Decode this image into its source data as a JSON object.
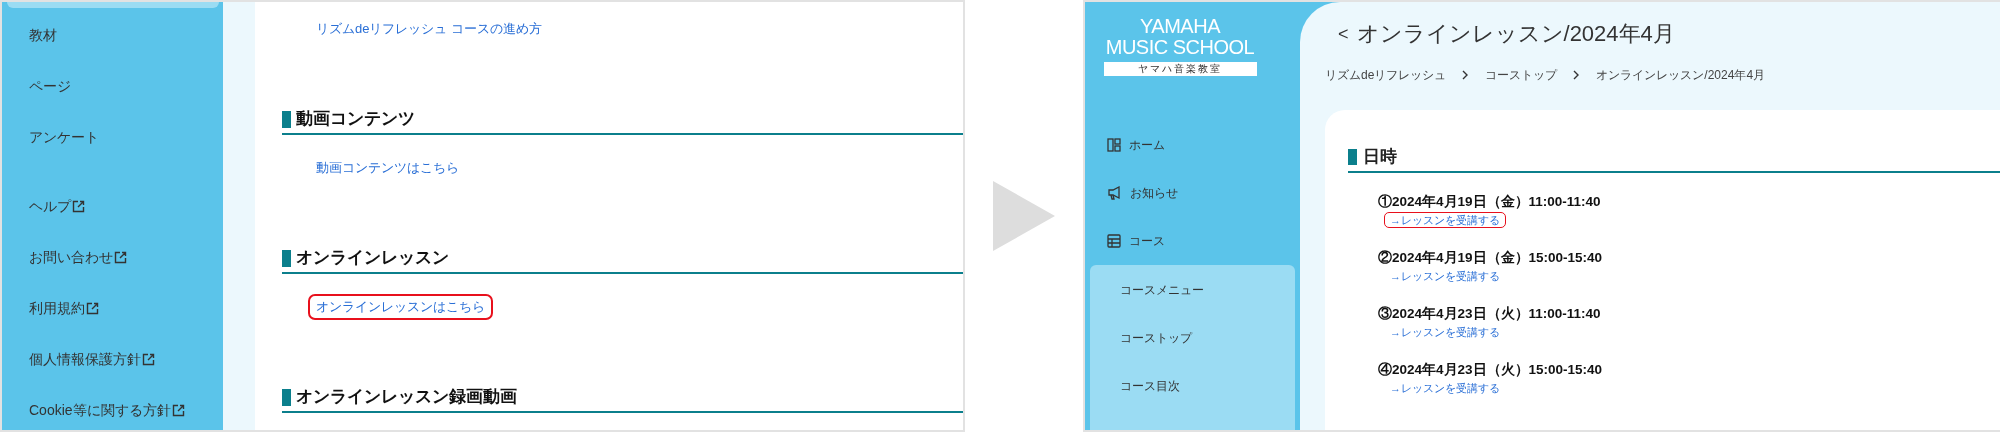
{
  "before": {
    "sidebar": {
      "items": [
        {
          "label": "教材"
        },
        {
          "label": "ページ"
        },
        {
          "label": "アンケート"
        }
      ],
      "external_links": [
        {
          "label": "ヘルプ"
        },
        {
          "label": "お問い合わせ"
        },
        {
          "label": "利用規約"
        },
        {
          "label": "個人情報保護方針"
        },
        {
          "label": "Cookie等に関する方針"
        }
      ]
    },
    "sections": [
      {
        "links": [
          {
            "label": "リズムdeリフレッシュ コースの進め方",
            "highlighted": false
          }
        ]
      },
      {
        "heading": "動画コンテンツ",
        "links": [
          {
            "label": "動画コンテンツはこちら",
            "highlighted": false
          }
        ]
      },
      {
        "heading": "オンラインレッスン",
        "links": [
          {
            "label": "オンラインレッスンはこちら",
            "highlighted": true
          }
        ]
      },
      {
        "heading": "オンラインレッスン録画動画"
      }
    ]
  },
  "after": {
    "logo": {
      "line_1": "YAMAHA",
      "line_2": "MUSIC SCHOOL",
      "subtitle": "ヤマハ音楽教室"
    },
    "nav": [
      {
        "label": "ホーム"
      },
      {
        "label": "お知らせ"
      },
      {
        "label": "コース",
        "children": [
          {
            "label": "コースメニュー"
          },
          {
            "label": "コーストップ"
          },
          {
            "label": "コース目次"
          }
        ]
      }
    ],
    "back": "<",
    "title": "オンラインレッスン/2024年4月",
    "breadcrumb": [
      "リズムdeリフレッシュ",
      "コーストップ",
      "オンラインレッスン/2024年4月"
    ],
    "heading": "日時",
    "sessions": [
      {
        "date": "①2024年4月19日（金）11:00-11:40",
        "link": "→レッスンを受講する",
        "highlighted": true
      },
      {
        "date": "②2024年4月19日（金）15:00-15:40",
        "link": "→レッスンを受講する",
        "highlighted": false
      },
      {
        "date": "③2024年4月23日（火）11:00-11:40",
        "link": "→レッスンを受講する",
        "highlighted": false
      },
      {
        "date": "④2024年4月23日（火）15:00-15:40",
        "link": "→レッスンを受講する",
        "highlighted": false
      }
    ]
  }
}
